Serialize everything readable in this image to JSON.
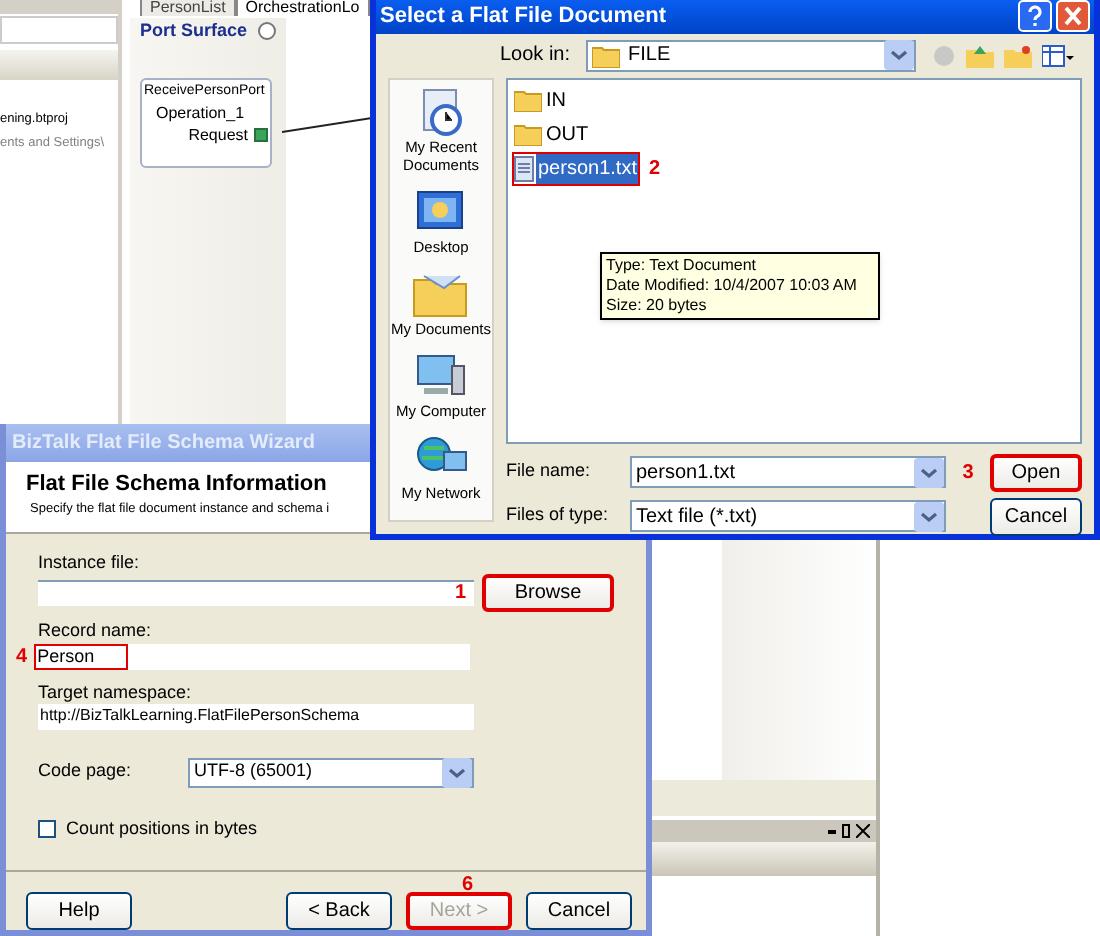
{
  "solution_explorer": {
    "lines": [
      "ening.btproj",
      "ents and Settings\\"
    ]
  },
  "designer": {
    "tabs": [
      {
        "label": "PersonList",
        "selected": false
      },
      {
        "label": "OrchestrationLo",
        "selected": true
      }
    ],
    "port_surface": {
      "title": "Port Surface",
      "port_name": "ReceivePersonPort",
      "operation": "Operation_1",
      "message": "Request"
    }
  },
  "file_dialog": {
    "title": "Select a Flat File Document",
    "look_in_label": "Look in:",
    "look_in_value": "FILE",
    "places": [
      {
        "label": "My Recent Documents",
        "kind": "recent"
      },
      {
        "label": "Desktop",
        "kind": "desktop"
      },
      {
        "label": "My Documents",
        "kind": "documents"
      },
      {
        "label": "My Computer",
        "kind": "computer"
      },
      {
        "label": "My Network",
        "kind": "network"
      }
    ],
    "files": [
      {
        "name": "IN",
        "kind": "folder",
        "selected": false
      },
      {
        "name": "OUT",
        "kind": "folder",
        "selected": false
      },
      {
        "name": "person1.txt",
        "kind": "file",
        "selected": true,
        "annotation": "2"
      }
    ],
    "tooltip": [
      "Type: Text Document",
      "Date Modified: 10/4/2007 10:03 AM",
      "Size: 20 bytes"
    ],
    "file_name_label": "File name:",
    "file_name": "person1.txt",
    "file_type_label": "Files of type:",
    "file_type": "Text file (*.txt)",
    "open_button": "Open",
    "open_annotation": "3",
    "cancel_button": "Cancel"
  },
  "wizard": {
    "title": "BizTalk Flat File Schema Wizard",
    "heading": "Flat File Schema Information",
    "subheading": "Specify the flat file document instance and schema i",
    "instance_file_label": "Instance file:",
    "instance_annotation": "1",
    "browse_button": "Browse",
    "record_name_label": "Record name:",
    "record_name": "Person",
    "record_annotation": "4",
    "namespace_label": "Target namespace:",
    "namespace": "http://BizTalkLearning.FlatFilePersonSchema",
    "code_page_label": "Code page:",
    "code_page": "UTF-8 (65001)",
    "count_positions": {
      "label": "Count positions in bytes",
      "checked": false
    },
    "buttons": [
      {
        "label": "Help",
        "disabled": false,
        "highlighted": false
      },
      {
        "label": "< Back",
        "disabled": false,
        "highlighted": false
      },
      {
        "label": "Next >",
        "disabled": true,
        "highlighted": true,
        "annotation": "6"
      },
      {
        "label": "Cancel",
        "disabled": false,
        "highlighted": false
      }
    ]
  }
}
